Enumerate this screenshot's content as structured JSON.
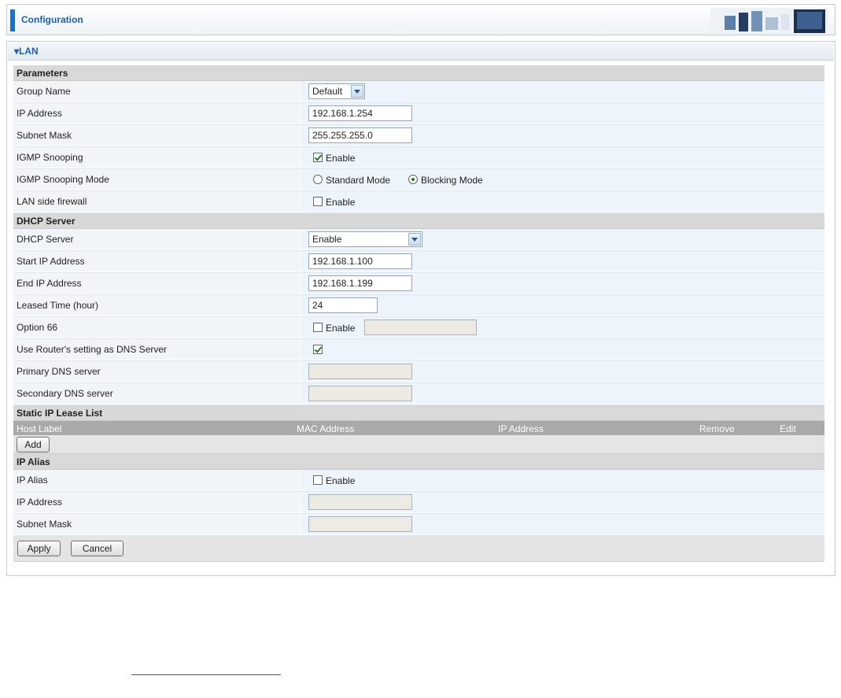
{
  "header": {
    "title": "Configuration"
  },
  "lan": {
    "title": "LAN"
  },
  "parameters": {
    "section": "Parameters",
    "group_name": {
      "label": "Group Name",
      "value": "Default"
    },
    "ip_address": {
      "label": "IP Address",
      "value": "192.168.1.254"
    },
    "subnet_mask": {
      "label": "Subnet Mask",
      "value": "255.255.255.0"
    },
    "igmp_snooping": {
      "label": "IGMP Snooping",
      "option": "Enable",
      "checked": true
    },
    "igmp_mode": {
      "label": "IGMP Snooping Mode",
      "option1": "Standard Mode",
      "option2": "Blocking Mode",
      "selected": "Blocking Mode"
    },
    "lan_firewall": {
      "label": "LAN side firewall",
      "option": "Enable",
      "checked": false
    }
  },
  "dhcp": {
    "section": "DHCP Server",
    "server": {
      "label": "DHCP Server",
      "value": "Enable"
    },
    "start_ip": {
      "label": "Start IP Address",
      "value": "192.168.1.100"
    },
    "end_ip": {
      "label": "End IP Address",
      "value": "192.168.1.199"
    },
    "leased": {
      "label": "Leased Time (hour)",
      "value": "24"
    },
    "option66": {
      "label": "Option 66",
      "option": "Enable",
      "checked": false,
      "value": ""
    },
    "use_router_dns": {
      "label": "Use Router's setting as DNS Server",
      "checked": true
    },
    "primary_dns": {
      "label": "Primary DNS server",
      "value": ""
    },
    "secondary_dns": {
      "label": "Secondary DNS server",
      "value": ""
    }
  },
  "static_lease": {
    "section": "Static IP Lease List",
    "columns": [
      "Host Label",
      "MAC Address",
      "IP Address",
      "Remove",
      "Edit"
    ],
    "add_label": "Add"
  },
  "ip_alias": {
    "section": "IP Alias",
    "alias": {
      "label": "IP Alias",
      "option": "Enable",
      "checked": false
    },
    "ip_address": {
      "label": "IP Address",
      "value": ""
    },
    "subnet_mask": {
      "label": "Subnet Mask",
      "value": ""
    }
  },
  "actions": {
    "apply": "Apply",
    "cancel": "Cancel"
  },
  "colors": {
    "accent": "#1a73c7",
    "title": "#1d5ea8",
    "section_bg": "#d8d8d8",
    "table_header": "#a9a9a9"
  }
}
